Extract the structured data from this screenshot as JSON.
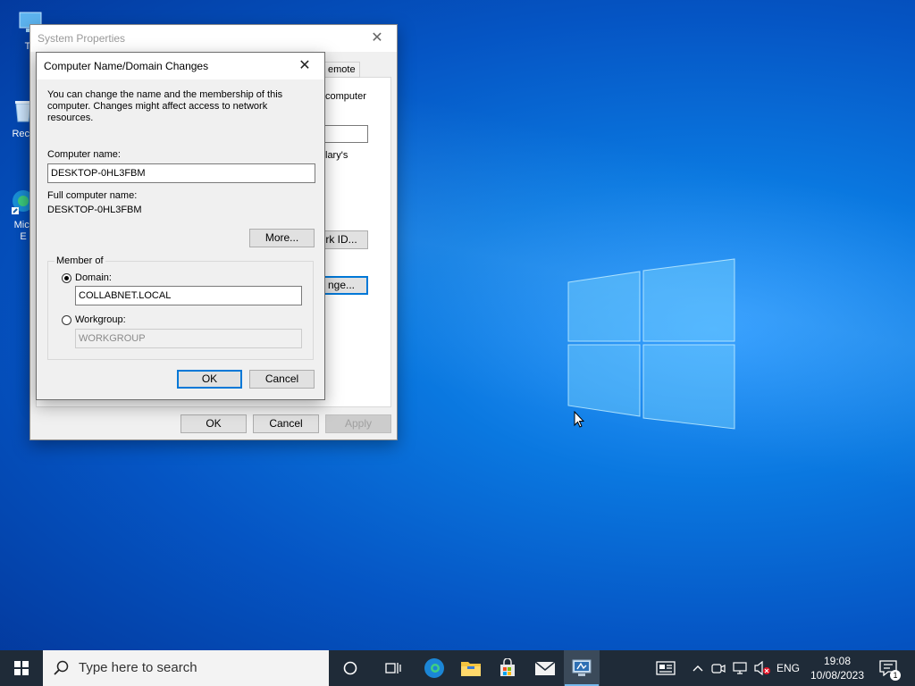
{
  "desktop": {
    "icons": [
      {
        "label": "Th"
      },
      {
        "label": "Recy"
      },
      {
        "label": "Micr\nE"
      }
    ]
  },
  "system_properties": {
    "title": "System Properties",
    "fragments": {
      "tab_remote": "emote",
      "computer_text": "computer",
      "primary_text": "lary's",
      "network_id_button": "rk ID...",
      "change_button": "nge..."
    },
    "ok_label": "OK",
    "cancel_label": "Cancel",
    "apply_label": "Apply"
  },
  "dialog": {
    "title": "Computer Name/Domain Changes",
    "description": "You can change the name and the membership of this computer. Changes might affect access to network resources.",
    "computer_name_label": "Computer name:",
    "computer_name_value": "DESKTOP-0HL3FBM",
    "full_name_label": "Full computer name:",
    "full_name_value": "DESKTOP-0HL3FBM",
    "more_label": "More...",
    "member_of_label": "Member of",
    "domain_label": "Domain:",
    "domain_value": "COLLABNET.LOCAL",
    "domain_selected": true,
    "workgroup_label": "Workgroup:",
    "workgroup_value": "WORKGROUP",
    "ok_label": "OK",
    "cancel_label": "Cancel"
  },
  "taskbar": {
    "search_placeholder": "Type here to search",
    "language": "ENG",
    "time": "19:08",
    "date": "10/08/2023",
    "notification_count": "1",
    "apps": [
      "task-view",
      "edge",
      "file-explorer",
      "store",
      "mail",
      "system-properties"
    ]
  },
  "colors": {
    "desktop_blue": "#0a78e0",
    "taskbar": "#1f2b38",
    "accent": "#0078d7"
  }
}
